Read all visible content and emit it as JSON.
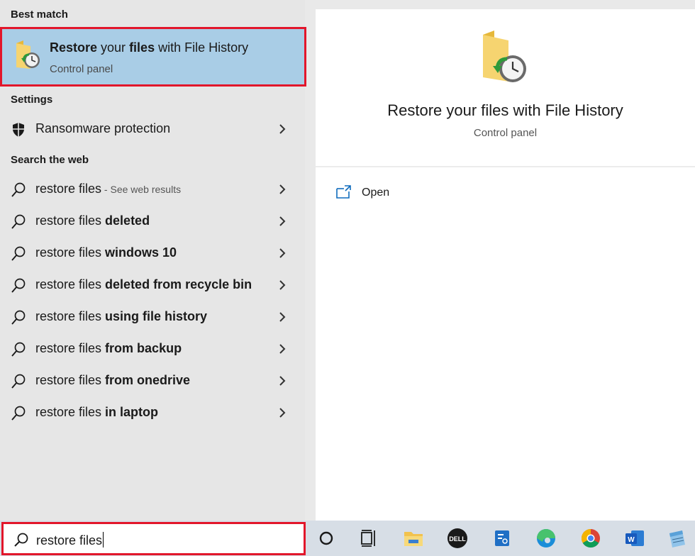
{
  "sections": {
    "best_match": "Best match",
    "settings": "Settings",
    "search_web": "Search the web"
  },
  "best_match": {
    "title_parts": [
      "Restore",
      " your ",
      "files",
      " with File History"
    ],
    "subtitle": "Control panel",
    "icon": "file-history-icon"
  },
  "settings_items": [
    {
      "label": "Ransomware protection",
      "icon": "shield-icon"
    }
  ],
  "web_items": [
    {
      "prefix": "restore files",
      "bold": "",
      "hint": " - See web results"
    },
    {
      "prefix": "restore files ",
      "bold": "deleted",
      "hint": ""
    },
    {
      "prefix": "restore files ",
      "bold": "windows 10",
      "hint": ""
    },
    {
      "prefix": "restore files ",
      "bold": "deleted from recycle bin",
      "hint": ""
    },
    {
      "prefix": "restore files ",
      "bold": "using file history",
      "hint": ""
    },
    {
      "prefix": "restore files ",
      "bold": "from backup",
      "hint": ""
    },
    {
      "prefix": "restore files ",
      "bold": "from onedrive",
      "hint": ""
    },
    {
      "prefix": "restore files ",
      "bold": "in laptop",
      "hint": ""
    }
  ],
  "preview": {
    "title": "Restore your files with File History",
    "subtitle": "Control panel",
    "actions": [
      {
        "label": "Open",
        "icon": "open-window-icon"
      }
    ]
  },
  "search": {
    "value": "restore files",
    "icon": "search-icon"
  },
  "taskbar": {
    "items": [
      "cortana-icon",
      "task-view-icon",
      "file-explorer-icon",
      "dell-icon",
      "app-icon",
      "edge-icon",
      "chrome-icon",
      "word-icon",
      "notepad-icon"
    ]
  },
  "colors": {
    "highlight_border": "#e2162b",
    "selected_bg": "#a9cde6",
    "left_pane_bg": "#e6e6e6",
    "taskbar_bg": "#d7dee6"
  }
}
